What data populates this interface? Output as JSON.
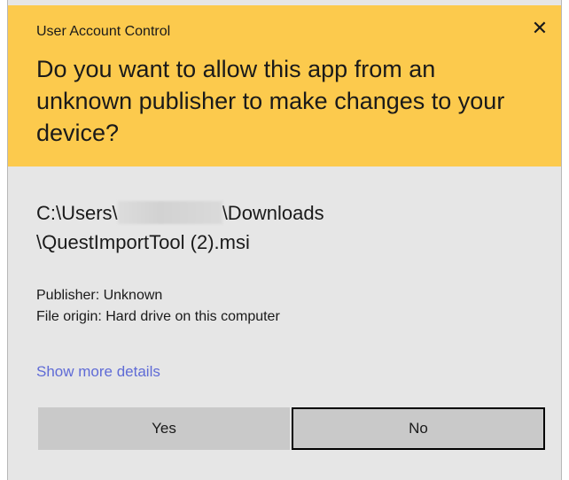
{
  "dialog": {
    "title": "User Account Control",
    "close_glyph": "✕",
    "question": "Do you want to allow this app from an unknown publisher to make changes to your device?",
    "path_prefix": "C:\\Users\\",
    "path_suffix_line1": "\\Downloads",
    "path_line2": "\\QuestImportTool (2).msi",
    "publisher": "Publisher: Unknown",
    "file_origin": "File origin: Hard drive on this computer",
    "show_details": "Show more details",
    "yes_label": "Yes",
    "no_label": "No"
  },
  "colors": {
    "header_bg": "#fcca4d",
    "body_bg": "#e6e6e6",
    "link": "#5f6bd6",
    "button_bg": "#c9c9c9"
  }
}
